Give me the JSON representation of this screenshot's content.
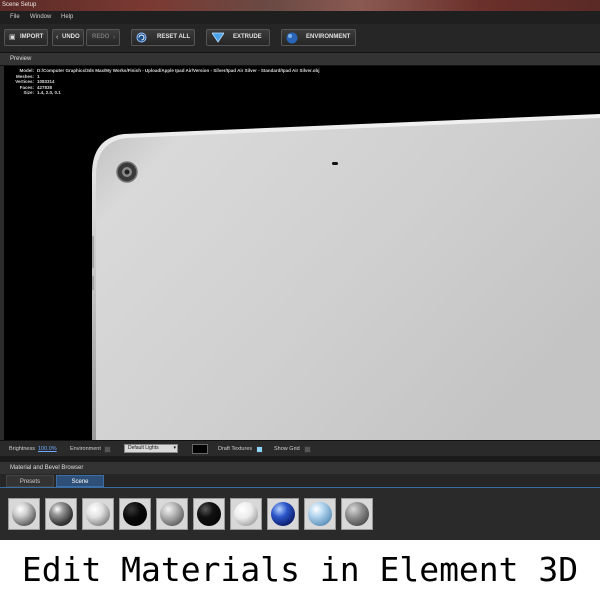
{
  "window": {
    "title": "Scene Setup"
  },
  "menu": [
    "File",
    "Window",
    "Help"
  ],
  "toolbar": {
    "import": "IMPORT",
    "undo": "UNDO",
    "redo": "REDO",
    "reset_all": "RESET ALL",
    "extrude": "EXTRUDE",
    "environment": "ENVIRONMENT"
  },
  "preview": {
    "label": "Preview",
    "info": {
      "model_label": "Model:",
      "model_value": "D:/Computer Graphics/3ds Max/My Works/Finish - Upload/Apple Ipad Air/Version - Silver/Ipad Air Silver - Standard/Ipad Air Silver.obj",
      "meshes_label": "Meshes:",
      "meshes_value": "1",
      "vertices_label": "Vertices:",
      "vertices_value": "1083314",
      "faces_label": "Faces:",
      "faces_value": "427838",
      "size_label": "Size:",
      "size_value": "1.4, 2.0, 0.1"
    }
  },
  "status": {
    "brightness_label": "Brightness",
    "brightness_value": "100.0%",
    "environment_label": "Environment",
    "lights_value": "Default Lights",
    "draft_textures_label": "Draft Textures",
    "draft_textures_checked": true,
    "show_grid_label": "Show Grid",
    "show_grid_checked": false
  },
  "material_browser": {
    "label": "Material and Bevel Browser",
    "tabs": [
      "Presets",
      "Scene"
    ],
    "active_tab": "Scene",
    "materials": [
      {
        "style": "chrome-light"
      },
      {
        "style": "chrome-dark"
      },
      {
        "style": "silver"
      },
      {
        "style": "black"
      },
      {
        "style": "grey-glossy"
      },
      {
        "style": "black-glossy"
      },
      {
        "style": "white-silver"
      },
      {
        "style": "blue-metal"
      },
      {
        "style": "light-blue"
      },
      {
        "style": "grey-rough"
      }
    ]
  },
  "caption": "Edit Materials in Element 3D"
}
